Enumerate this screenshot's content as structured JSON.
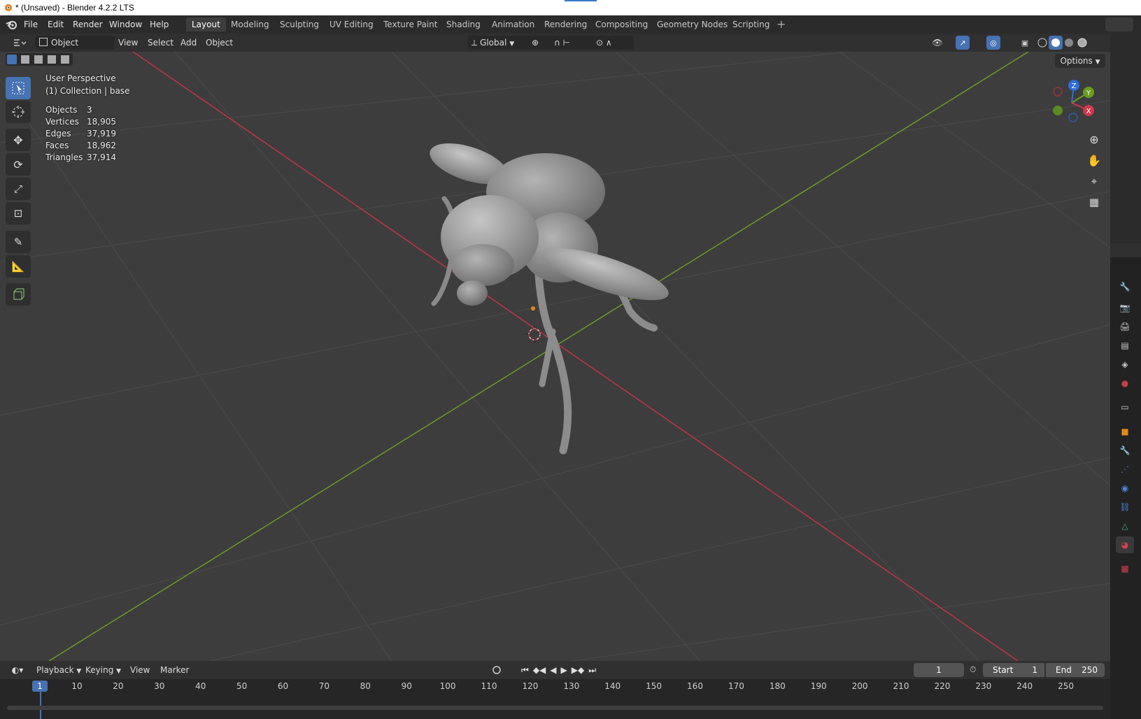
{
  "window": {
    "title": "* (Unsaved) - Blender 4.2.2 LTS"
  },
  "menu": [
    "File",
    "Edit",
    "Render",
    "Window",
    "Help"
  ],
  "workspaces": [
    {
      "label": "Layout",
      "active": true
    },
    {
      "label": "Modeling"
    },
    {
      "label": "Sculpting"
    },
    {
      "label": "UV Editing"
    },
    {
      "label": "Texture Paint"
    },
    {
      "label": "Shading"
    },
    {
      "label": "Animation"
    },
    {
      "label": "Rendering"
    },
    {
      "label": "Compositing"
    },
    {
      "label": "Geometry Nodes"
    },
    {
      "label": "Scripting"
    }
  ],
  "header": {
    "mode": "Object Mode",
    "menus": [
      "View",
      "Select",
      "Add",
      "Object"
    ],
    "orientation": "Global",
    "options": "Options"
  },
  "viewport": {
    "perspective": "User Perspective",
    "collection": "(1) Collection | base",
    "stats": [
      {
        "label": "Objects",
        "value": "3"
      },
      {
        "label": "Vertices",
        "value": "18,905"
      },
      {
        "label": "Edges",
        "value": "37,919"
      },
      {
        "label": "Faces",
        "value": "18,962"
      },
      {
        "label": "Triangles",
        "value": "37,914"
      }
    ],
    "gizmo": {
      "z": "Z",
      "y": "Y",
      "x": "X"
    }
  },
  "timeline": {
    "menus": [
      "Playback",
      "Keying",
      "View",
      "Marker"
    ],
    "current_frame": "1",
    "start_label": "Start",
    "start": "1",
    "end_label": "End",
    "end": "250",
    "ticks": [
      "1",
      "10",
      "20",
      "30",
      "40",
      "50",
      "60",
      "70",
      "80",
      "90",
      "100",
      "110",
      "120",
      "130",
      "140",
      "150",
      "160",
      "170",
      "180",
      "190",
      "200",
      "210",
      "220",
      "230",
      "240",
      "250"
    ]
  },
  "colors": {
    "accent": "#4772b3",
    "x_axis": "#d0384c",
    "y_axis": "#6a9c1e"
  }
}
